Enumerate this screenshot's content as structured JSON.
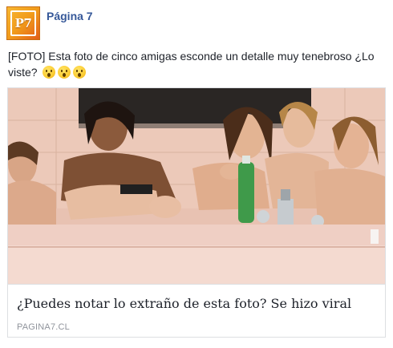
{
  "page": {
    "name": "Página 7",
    "avatar_text": "P7"
  },
  "post": {
    "caption": "[FOTO] Esta foto de cinco amigas esconde un detalle muy tenebroso ¿Lo viste?",
    "emojis": [
      "astonished-face-emoji",
      "astonished-face-emoji",
      "astonished-face-emoji"
    ]
  },
  "link": {
    "title": "¿Puedes notar lo extraño de esta foto? Se hizo viral",
    "domain": "PAGINA7.CL",
    "image": "photo-of-five-friends-in-bathtub"
  },
  "colors": {
    "page_name": "#365899",
    "text": "#1d2129",
    "domain": "#90949c",
    "border": "#dddfe2",
    "avatar_orange": "#f19b1b"
  }
}
